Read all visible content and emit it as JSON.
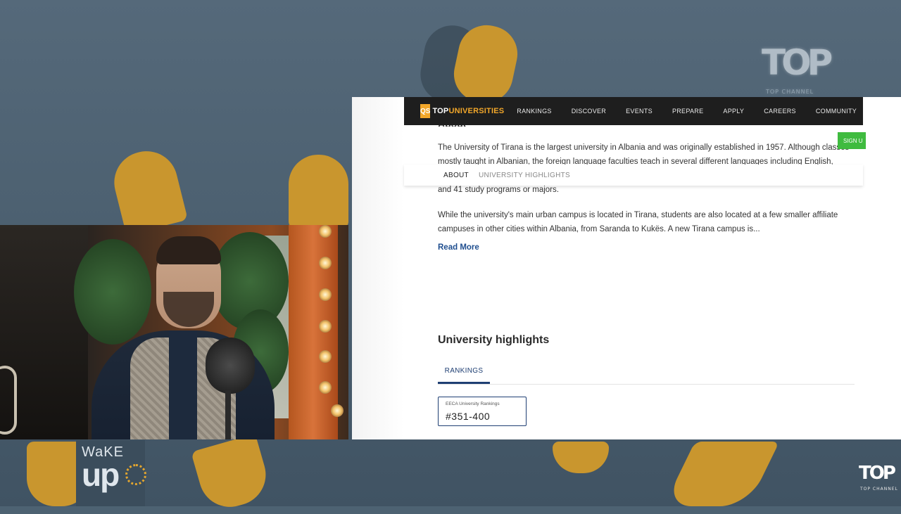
{
  "broadcast": {
    "channel_logo_top": "TOP",
    "channel_logo_top_sub": "TOP CHANNEL",
    "channel_logo_bottom": "TOP",
    "channel_logo_bottom_sub": "TOP CHANNEL",
    "show_logo_line1": "WaKE",
    "show_logo_line2": "up"
  },
  "website": {
    "brand_badge": "QS",
    "brand_name_1": "TOP",
    "brand_name_2": "UNIVERSITIES",
    "nav": [
      "RANKINGS",
      "DISCOVER",
      "EVENTS",
      "PREPARE",
      "APPLY",
      "CAREERS",
      "COMMUNITY"
    ],
    "signup_label": "SIGN U",
    "section_heading": "About",
    "subnav": [
      "ABOUT",
      "UNIVERSITY HIGHLIGHTS"
    ],
    "paragraph1_line1": "The University of Tirana is the largest university in Albania and was originally established in 1957. Although classes",
    "paragraph1_line2": "mostly taught in Albanian, the foreign language faculties teach in several different languages including English, Chinese,",
    "paragraph1_line3": "and 41 study programs or majors.",
    "paragraph2_line1": "While the university's main urban campus is located in Tirana, students are also located at a few smaller affiliate",
    "paragraph2_line2": "campuses in other cities within Albania, from Saranda to Kukës. A new Tirana campus is...",
    "read_more": "Read More",
    "highlights_title": "University highlights",
    "highlights_tab": "RANKINGS",
    "ranking_card": {
      "label": "EECA University Rankings",
      "value": "#351-400"
    }
  },
  "colors": {
    "accent_gold": "#f2a72a",
    "navbar": "#1e1e1e",
    "link_blue": "#1f4e8f",
    "signup_green": "#3fbb3f"
  }
}
